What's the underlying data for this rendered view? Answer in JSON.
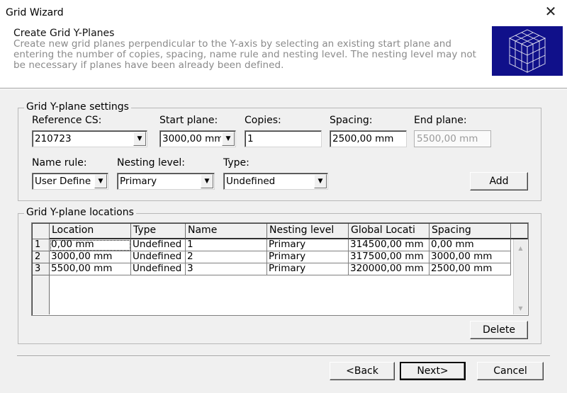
{
  "window": {
    "title": "Grid Wizard",
    "close_label": "✕"
  },
  "header": {
    "title": "Create Grid Y-Planes",
    "description": "Create new grid planes perpendicular to the Y-axis by selecting an existing start plane and entering the number of copies, spacing, name rule and nesting level. The nesting level may not be necessary if planes have been already been defined.",
    "logo_icon": "wireframe-cube-icon",
    "logo_color": "#10108a"
  },
  "settings": {
    "legend": "Grid Y-plane settings",
    "reference_cs": {
      "label": "Reference CS:",
      "value": "210723"
    },
    "start_plane": {
      "label": "Start plane:",
      "value": "3000,00 mm"
    },
    "copies": {
      "label": "Copies:",
      "value": "1"
    },
    "spacing": {
      "label": "Spacing:",
      "value": "2500,00 mm"
    },
    "end_plane": {
      "label": "End plane:",
      "value": "5500,00 mm"
    },
    "name_rule": {
      "label": "Name rule:",
      "value": "User Define"
    },
    "nesting_level": {
      "label": "Nesting level:",
      "value": "Primary"
    },
    "type": {
      "label": "Type:",
      "value": "Undefined"
    },
    "add_label": "Add"
  },
  "locations": {
    "legend": "Grid Y-plane locations",
    "columns": [
      "Location",
      "Type",
      "Name",
      "Nesting level",
      "Global Locati",
      "Spacing"
    ],
    "rows": [
      {
        "num": "1",
        "cells": [
          "0,00 mm",
          "Undefined",
          "1",
          "Primary",
          "314500,00 mm",
          "0,00 mm"
        ]
      },
      {
        "num": "2",
        "cells": [
          "3000,00 mm",
          "Undefined",
          "2",
          "Primary",
          "317500,00 mm",
          "3000,00 mm"
        ]
      },
      {
        "num": "3",
        "cells": [
          "5500,00 mm",
          "Undefined",
          "3",
          "Primary",
          "320000,00 mm",
          "2500,00 mm"
        ]
      }
    ],
    "delete_label": "Delete"
  },
  "footer": {
    "back_label": "<Back",
    "next_label": "Next>",
    "cancel_label": "Cancel"
  }
}
